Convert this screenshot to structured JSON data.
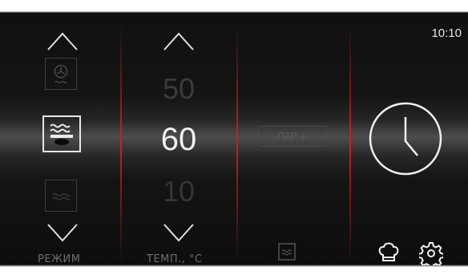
{
  "status": {
    "time": "10:10"
  },
  "mode": {
    "label": "РЕЖИМ",
    "items": [
      "fan-mode-icon",
      "top-bottom-heat-icon",
      "bottom-heat-icon"
    ],
    "selected": "top-bottom-heat-icon"
  },
  "temperature": {
    "label": "ТЕМП., °C",
    "prev": "50",
    "current": "60",
    "next": "10"
  },
  "steam_button": {
    "label": "ПАР +"
  },
  "icons": [
    "clock-icon",
    "chef-hat-icon",
    "settings-gear-icon",
    "tray-icon"
  ],
  "colors": {
    "divider": "#d21e1e",
    "text": "#f2f2f2",
    "dim": "#3b3b3b"
  }
}
